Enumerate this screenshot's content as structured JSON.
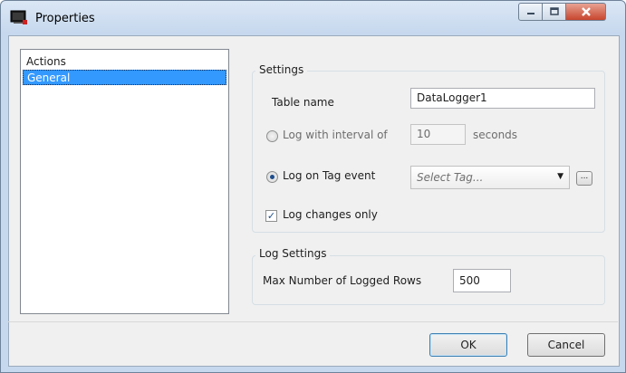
{
  "window": {
    "title": "Properties",
    "buttons": {
      "minimize_icon": "minimize-icon",
      "maximize_icon": "maximize-icon",
      "close_icon": "close-icon"
    }
  },
  "nav": {
    "items": [
      {
        "label": "Actions",
        "selected": false
      },
      {
        "label": "General",
        "selected": true
      }
    ]
  },
  "settings": {
    "title": "Settings",
    "table_name_label": "Table name",
    "table_name_value": "DataLogger1",
    "interval": {
      "label": "Log with interval of",
      "value": "10",
      "unit": "seconds",
      "selected": false,
      "enabled": false
    },
    "tag_event": {
      "label": "Log on Tag event",
      "selected": true,
      "placeholder": "Select Tag...",
      "browse_label": "..."
    },
    "log_changes": {
      "label": "Log changes only",
      "checked": true
    }
  },
  "log_settings": {
    "title": "Log Settings",
    "max_rows_label": "Max Number of Logged Rows",
    "max_rows_value": "500"
  },
  "footer": {
    "ok_label": "OK",
    "cancel_label": "Cancel"
  },
  "colors": {
    "selection": "#3399ff",
    "close_button": "#c7452d"
  }
}
